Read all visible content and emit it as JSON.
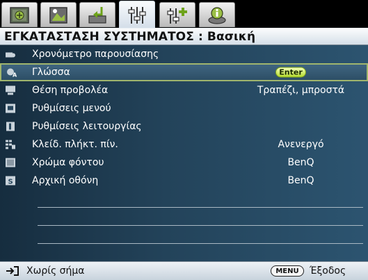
{
  "tabs": [
    {
      "icon": "display-icon",
      "active": false
    },
    {
      "icon": "picture-icon",
      "active": false
    },
    {
      "icon": "source-icon",
      "active": false
    },
    {
      "icon": "system-setup-basic-icon",
      "active": true
    },
    {
      "icon": "system-setup-advanced-icon",
      "active": false
    },
    {
      "icon": "information-icon",
      "active": false
    }
  ],
  "header": {
    "title": "ΕΓΚΑΤΑΣΤΑΣΗ ΣΥΣΤΗΜΑΤΟΣ : Βασική"
  },
  "menu": {
    "items": [
      {
        "icon": "timer-icon",
        "label": "Χρονόμετρο παρουσίασης",
        "value": ""
      },
      {
        "icon": "language-icon",
        "label": "Γλώσσα",
        "value": "",
        "button": "Enter",
        "selected": true
      },
      {
        "icon": "projector-position-icon",
        "label": "Θέση προβολέα",
        "value": "Τραπέζι, μπροστά"
      },
      {
        "icon": "menu-settings-icon",
        "label": "Ρυθμίσεις μενού",
        "value": ""
      },
      {
        "icon": "operation-settings-icon",
        "label": "Ρυθμίσεις λειτουργίας",
        "value": ""
      },
      {
        "icon": "keypad-lock-icon",
        "label": "Κλείδ. πλήκτ. πίν.",
        "value": "Ανενεργό"
      },
      {
        "icon": "background-color-icon",
        "label": "Χρώμα φόντου",
        "value": "BenQ"
      },
      {
        "icon": "splash-screen-icon",
        "label": "Αρχική οθόνη",
        "value": "BenQ"
      }
    ]
  },
  "footer": {
    "source_text": "Χωρίς σήμα",
    "menu_key": "MENU",
    "exit_text": "Έξοδος"
  },
  "colors": {
    "accent": "#b6dc2f",
    "menu_bg": "#23435a",
    "selected_border": "#a0b56d"
  }
}
